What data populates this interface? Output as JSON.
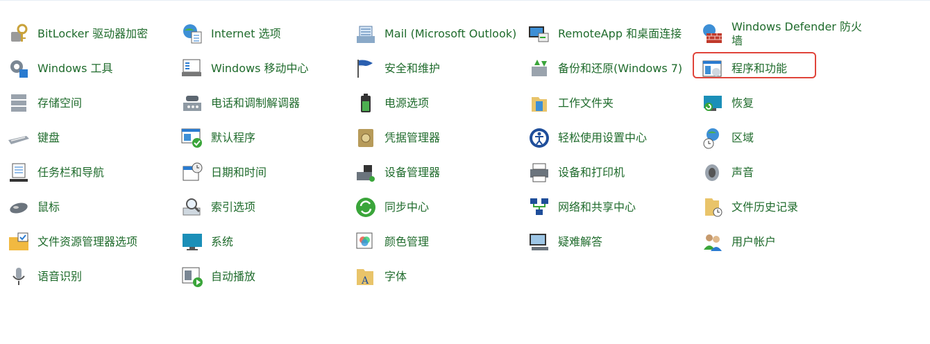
{
  "highlight_color": "#e0443a",
  "label_color": "#1f6b2c",
  "items": [
    {
      "name": "bitlocker",
      "icon": "bitlocker-key-icon",
      "label": "BitLocker 驱动器加密"
    },
    {
      "name": "internet-options",
      "icon": "internet-options-icon",
      "label": "Internet 选项"
    },
    {
      "name": "mail",
      "icon": "mail-icon",
      "label": "Mail (Microsoft Outlook)"
    },
    {
      "name": "remoteapp",
      "icon": "remoteapp-icon",
      "label": "RemoteApp 和桌面连接"
    },
    {
      "name": "windows-defender-firewall",
      "icon": "firewall-icon",
      "label": "Windows Defender 防火墙"
    },
    {
      "name": "windows-tools",
      "icon": "windows-tools-icon",
      "label": "Windows 工具"
    },
    {
      "name": "windows-mobility-center",
      "icon": "mobility-center-icon",
      "label": "Windows 移动中心"
    },
    {
      "name": "security-maintenance",
      "icon": "security-flag-icon",
      "label": "安全和维护"
    },
    {
      "name": "backup-restore",
      "icon": "backup-restore-icon",
      "label": "备份和还原(Windows 7)"
    },
    {
      "name": "programs-features",
      "icon": "programs-features-icon",
      "label": "程序和功能"
    },
    {
      "name": "storage-spaces",
      "icon": "storage-spaces-icon",
      "label": "存储空间"
    },
    {
      "name": "phone-modem",
      "icon": "phone-modem-icon",
      "label": "电话和调制解调器"
    },
    {
      "name": "power-options",
      "icon": "battery-icon",
      "label": "电源选项"
    },
    {
      "name": "work-folders",
      "icon": "work-folders-icon",
      "label": "工作文件夹"
    },
    {
      "name": "recovery",
      "icon": "recovery-icon",
      "label": "恢复"
    },
    {
      "name": "keyboard",
      "icon": "keyboard-icon",
      "label": "键盘"
    },
    {
      "name": "default-programs",
      "icon": "default-programs-icon",
      "label": "默认程序"
    },
    {
      "name": "credential-manager",
      "icon": "credential-safe-icon",
      "label": "凭据管理器"
    },
    {
      "name": "ease-of-access",
      "icon": "ease-of-access-icon",
      "label": "轻松使用设置中心"
    },
    {
      "name": "region",
      "icon": "region-globe-icon",
      "label": "区域"
    },
    {
      "name": "taskbar-navigation",
      "icon": "taskbar-icon",
      "label": "任务栏和导航"
    },
    {
      "name": "date-time",
      "icon": "calendar-clock-icon",
      "label": "日期和时间"
    },
    {
      "name": "device-manager",
      "icon": "device-manager-icon",
      "label": "设备管理器"
    },
    {
      "name": "devices-printers",
      "icon": "printer-icon",
      "label": "设备和打印机"
    },
    {
      "name": "sound",
      "icon": "speaker-icon",
      "label": "声音"
    },
    {
      "name": "mouse",
      "icon": "mouse-icon",
      "label": "鼠标"
    },
    {
      "name": "indexing-options",
      "icon": "magnifier-icon",
      "label": "索引选项"
    },
    {
      "name": "sync-center",
      "icon": "sync-icon",
      "label": "同步中心"
    },
    {
      "name": "network-sharing-center",
      "icon": "network-icon",
      "label": "网络和共享中心"
    },
    {
      "name": "file-history",
      "icon": "file-history-icon",
      "label": "文件历史记录"
    },
    {
      "name": "file-explorer-options",
      "icon": "folder-check-icon",
      "label": "文件资源管理器选项"
    },
    {
      "name": "system",
      "icon": "monitor-icon",
      "label": "系统"
    },
    {
      "name": "color-management",
      "icon": "color-management-icon",
      "label": "颜色管理"
    },
    {
      "name": "troubleshooting",
      "icon": "troubleshooting-icon",
      "label": "疑难解答"
    },
    {
      "name": "user-accounts",
      "icon": "users-icon",
      "label": "用户帐户"
    },
    {
      "name": "speech-recognition",
      "icon": "microphone-icon",
      "label": "语音识别"
    },
    {
      "name": "autoplay",
      "icon": "autoplay-icon",
      "label": "自动播放"
    },
    {
      "name": "fonts",
      "icon": "fonts-icon",
      "label": "字体"
    }
  ]
}
